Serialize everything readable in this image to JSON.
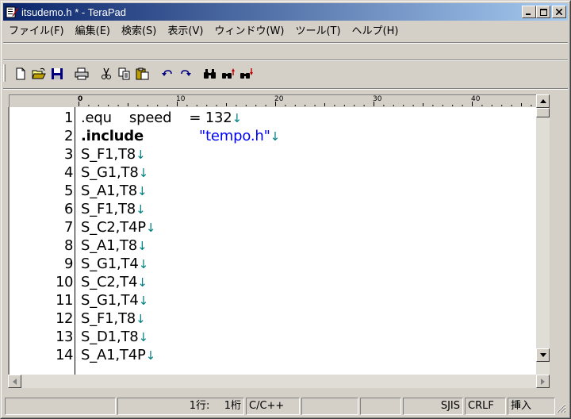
{
  "window": {
    "title": "itsudemo.h * - TeraPad",
    "buttons": {
      "minimize": "minimize",
      "maximize": "maximize",
      "close": "close"
    }
  },
  "menu": [
    "ファイル(F)",
    "編集(E)",
    "検索(S)",
    "表示(V)",
    "ウィンドウ(W)",
    "ツール(T)",
    "ヘルプ(H)"
  ],
  "toolbar": {
    "icons": [
      "new-file-icon",
      "open-folder-icon",
      "save-icon",
      "print-icon",
      "cut-icon",
      "copy-icon",
      "paste-icon",
      "undo-icon",
      "redo-icon",
      "find-icon",
      "find-prev-icon",
      "find-next-icon"
    ]
  },
  "ruler": {
    "marks": [
      "0",
      "10",
      "20",
      "30",
      "40"
    ]
  },
  "editor": {
    "lines": [
      {
        "no": "1",
        "parts": [
          ".equ    speed    = 132"
        ]
      },
      {
        "no": "2",
        "parts": [
          ".include",
          "\"tempo.h\""
        ]
      },
      {
        "no": "3",
        "parts": [
          "S_F1,T8"
        ]
      },
      {
        "no": "4",
        "parts": [
          "S_G1,T8"
        ]
      },
      {
        "no": "5",
        "parts": [
          "S_A1,T8"
        ]
      },
      {
        "no": "6",
        "parts": [
          "S_F1,T8"
        ]
      },
      {
        "no": "7",
        "parts": [
          "S_C2,T4P"
        ]
      },
      {
        "no": "8",
        "parts": [
          "S_A1,T8"
        ]
      },
      {
        "no": "9",
        "parts": [
          "S_G1,T4"
        ]
      },
      {
        "no": "10",
        "parts": [
          "S_C2,T4"
        ]
      },
      {
        "no": "11",
        "parts": [
          "S_G1,T4"
        ]
      },
      {
        "no": "12",
        "parts": [
          "S_F1,T8"
        ]
      },
      {
        "no": "13",
        "parts": [
          "S_D1,T8"
        ]
      },
      {
        "no": "14",
        "parts": [
          "S_A1,T4P"
        ]
      }
    ],
    "newline_mark": "↓"
  },
  "status": {
    "line": "1行:",
    "col": "1桁",
    "mode": "C/C++",
    "encoding": "SJIS",
    "line_ending": "CRLF",
    "insert": "挿入"
  },
  "colors": {
    "string": "#0000ff",
    "newline_mark": "#008080",
    "title_start": "#0a246a",
    "title_end": "#a6caf0"
  }
}
